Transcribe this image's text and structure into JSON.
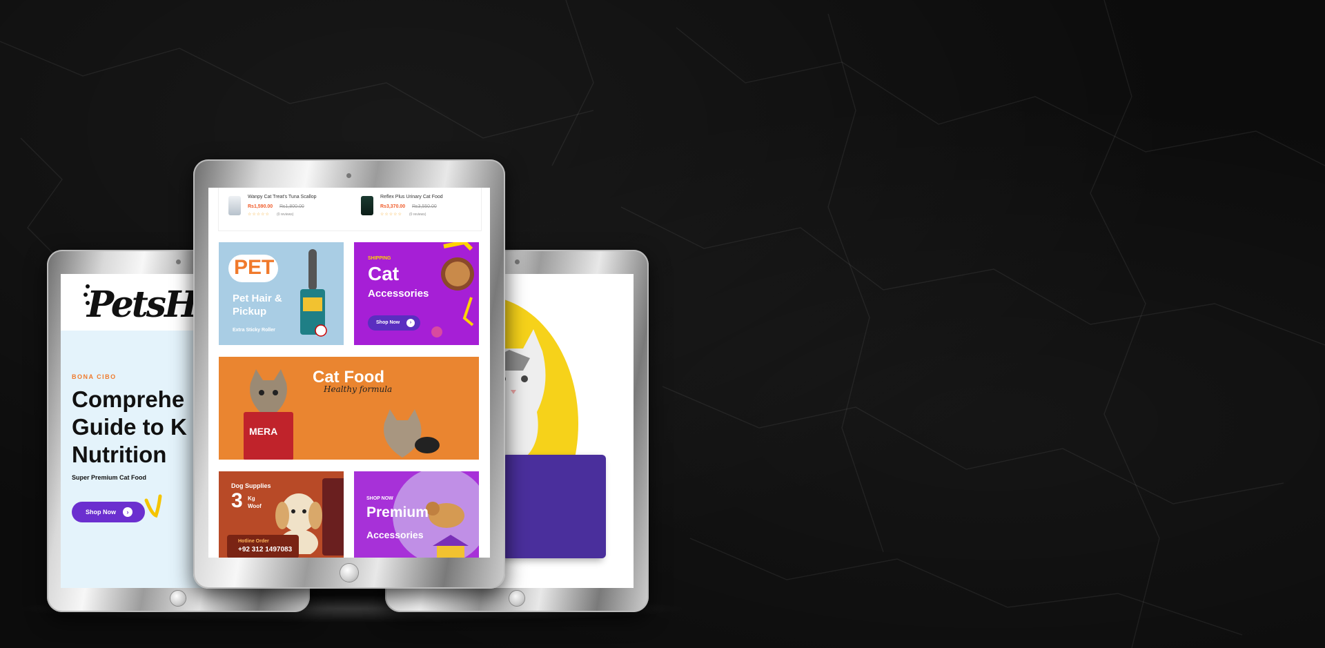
{
  "left_tablet": {
    "logo": "PetsHe",
    "eyebrow": "BONA CIBO",
    "title": "Comprehe\nGuide to K\nNutrition",
    "subtitle": "Super Premium Cat Food",
    "shop_button": "Shop Now"
  },
  "center_tablet": {
    "products": [
      {
        "name": "Wanpy Cat Treat's Tuna Scallop",
        "price": "Rs1,590.00",
        "old_price": "Rs1,800.00",
        "stars": "☆☆☆☆☆",
        "reviews": "(0 reviews)"
      },
      {
        "name": "Reflex Plus Urinary Cat Food",
        "price": "Rs3,370.00",
        "old_price": "Rs3,550.00",
        "stars": "☆☆☆☆☆",
        "reviews": "(0 reviews)"
      }
    ],
    "pet_banner": {
      "word": "PET",
      "subtitle": "Pet Hair &\nPickup",
      "tag": "Extra Sticky Roller"
    },
    "cat_accessories": {
      "tag": "SHIPPING",
      "big": "Cat",
      "sub": "Accessories",
      "button": "Shop Now"
    },
    "cat_food": {
      "title": "Cat Food",
      "subtitle": "Healthy formula",
      "brand": "MERA"
    },
    "dog_supplies": {
      "title": "Dog Supplies",
      "number": "3",
      "unit": "Kg\nWoof",
      "hotline_label": "Hotline Order",
      "phone": "+92 312 1497083"
    },
    "premium": {
      "tag": "SHOP NOW",
      "big": "Premium",
      "sub": "Accessories"
    }
  },
  "colors": {
    "accent_purple": "#6b2fcf",
    "orange": "#ea8530",
    "magenta": "#a61fd6",
    "price": "#f05a28"
  }
}
